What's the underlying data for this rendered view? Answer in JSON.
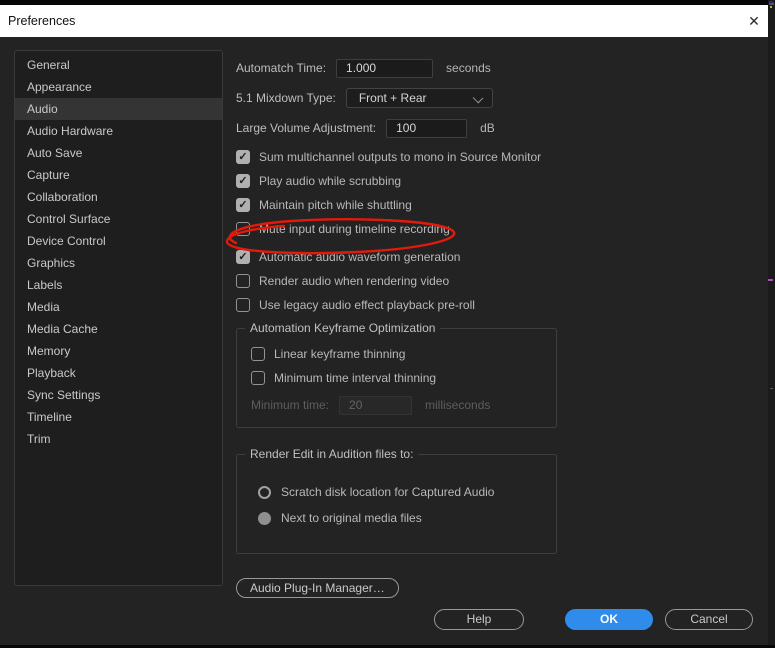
{
  "window": {
    "title": "Preferences"
  },
  "icons": {
    "check": "✓",
    "close": "✕"
  },
  "sidebar": {
    "items": [
      {
        "label": "General",
        "selected": false
      },
      {
        "label": "Appearance",
        "selected": false
      },
      {
        "label": "Audio",
        "selected": true
      },
      {
        "label": "Audio Hardware",
        "selected": false
      },
      {
        "label": "Auto Save",
        "selected": false
      },
      {
        "label": "Capture",
        "selected": false
      },
      {
        "label": "Collaboration",
        "selected": false
      },
      {
        "label": "Control Surface",
        "selected": false
      },
      {
        "label": "Device Control",
        "selected": false
      },
      {
        "label": "Graphics",
        "selected": false
      },
      {
        "label": "Labels",
        "selected": false
      },
      {
        "label": "Media",
        "selected": false
      },
      {
        "label": "Media Cache",
        "selected": false
      },
      {
        "label": "Memory",
        "selected": false
      },
      {
        "label": "Playback",
        "selected": false
      },
      {
        "label": "Sync Settings",
        "selected": false
      },
      {
        "label": "Timeline",
        "selected": false
      },
      {
        "label": "Trim",
        "selected": false
      }
    ]
  },
  "main": {
    "fields": {
      "automatch": {
        "label": "Automatch Time:",
        "value": "1.000",
        "suffix": "seconds"
      },
      "mixdown": {
        "label": "5.1 Mixdown Type:",
        "value": "Front + Rear"
      },
      "volume": {
        "label": "Large Volume Adjustment:",
        "value": "100",
        "suffix": "dB"
      }
    },
    "checkboxes": [
      {
        "label": "Sum multichannel outputs to mono in Source Monitor",
        "checked": true
      },
      {
        "label": "Play audio while scrubbing",
        "checked": true
      },
      {
        "label": "Maintain pitch while shuttling",
        "checked": true
      },
      {
        "label": "Mute input during timeline recording",
        "checked": false,
        "annotated_with_red_circle": true
      },
      {
        "label": "Automatic audio waveform generation",
        "checked": true
      },
      {
        "label": "Render audio when rendering video",
        "checked": false
      },
      {
        "label": "Use legacy audio effect playback pre-roll",
        "checked": false
      }
    ],
    "automation_group": {
      "title": "Automation Keyframe Optimization",
      "checkboxes": [
        {
          "label": "Linear keyframe thinning",
          "checked": false
        },
        {
          "label": "Minimum time interval thinning",
          "checked": false
        }
      ],
      "minimum_time": {
        "label": "Minimum time:",
        "value": "20",
        "suffix": "milliseconds",
        "disabled": true
      }
    },
    "audition_group": {
      "title": "Render Edit in Audition files to:",
      "radios": [
        {
          "label": "Scratch disk location for Captured Audio",
          "selected": false
        },
        {
          "label": "Next to original media files",
          "selected": true
        }
      ]
    },
    "plugin_button": "Audio Plug-In Manager…"
  },
  "footer": {
    "help": "Help",
    "ok": "OK",
    "cancel": "Cancel"
  },
  "colors": {
    "accent": "#2f8ceb",
    "annotation": "#e21a0c",
    "titlebar": "#ffffff",
    "dialog_bg": "#232323",
    "sidebar_selected": "#343434"
  }
}
